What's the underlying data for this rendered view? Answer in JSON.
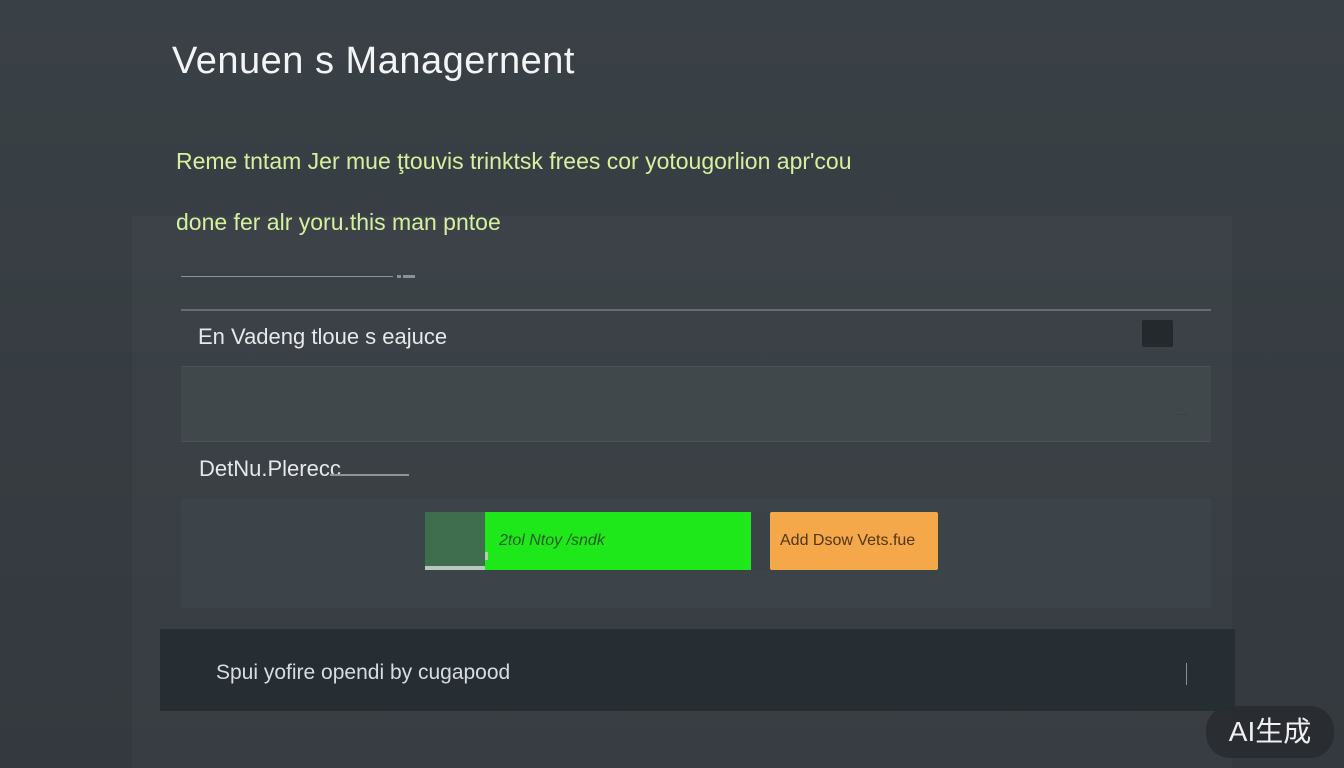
{
  "header": {
    "title": "Venuen s Managernent"
  },
  "intro": {
    "line1": "Reme tntam Jer mue ţtouvis trinktsk frees cor yotougorlion apr'cou",
    "line2": "done fer alr yoru.this man pntoe"
  },
  "form": {
    "row1_label": "En Vadeng tloue s eajuce",
    "input_value": "",
    "row2_label": "DetNu.Plerecc"
  },
  "actions": {
    "green_label": "2tol Ntoy /sndk",
    "orange_label": "Add Dsow Vets.fue"
  },
  "footer": {
    "text": "Spui yofire opendi by cugapood"
  },
  "watermark": {
    "text": "AI生成"
  },
  "colors": {
    "background": "#353b40",
    "accent_green": "#1ee81a",
    "accent_orange": "#f5a84a",
    "intro_text": "#d6f0a0",
    "footer_bar": "#272e33"
  }
}
